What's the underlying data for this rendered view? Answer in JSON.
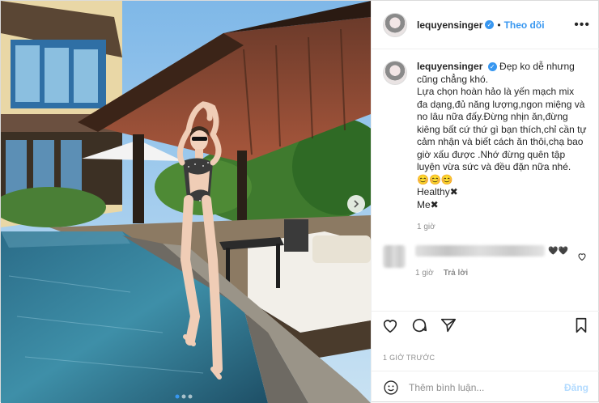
{
  "post": {
    "username": "lequyensinger",
    "verified": true,
    "follow_label": "Theo dõi",
    "separator": "•",
    "more_label": "•••",
    "caption": "Đẹp ko dễ nhưng cũng chẳng khó.\nLựa chọn hoàn hảo là yến mạch mix đa dạng,đủ năng lượng,ngon miệng và no lâu nữa đấy.Đừng nhịn ăn,đừng kiêng bất cứ thứ gì bạn thích,chỉ cần tự cảm nhận và biết cách ăn thôi,chạ bao giờ xấu được .Nhớ đừng quên tập luyện vừa sức và đều đặn nữa nhé.\n😊😊😊\nHealthy✖\nMe✖",
    "caption_time": "1 giờ",
    "comment_emoji": "🖤🖤",
    "comment_time": "1 giờ",
    "reply_label": "Trả lời",
    "date_label": "1 GIỜ TRƯỚC",
    "add_comment_placeholder": "Thêm bình luận...",
    "post_button_label": "Đăng",
    "carousel_dots": 3,
    "carousel_active_index": 0
  },
  "icons": [
    "heart-icon",
    "comment-icon",
    "share-icon",
    "bookmark-icon",
    "emoji-icon",
    "more-options-icon",
    "verified-icon",
    "next-arrow-icon",
    "small-heart-icon"
  ],
  "colors": {
    "accent": "#3897f0",
    "muted": "#8e8e8e",
    "post_disabled": "#b3dbff"
  }
}
